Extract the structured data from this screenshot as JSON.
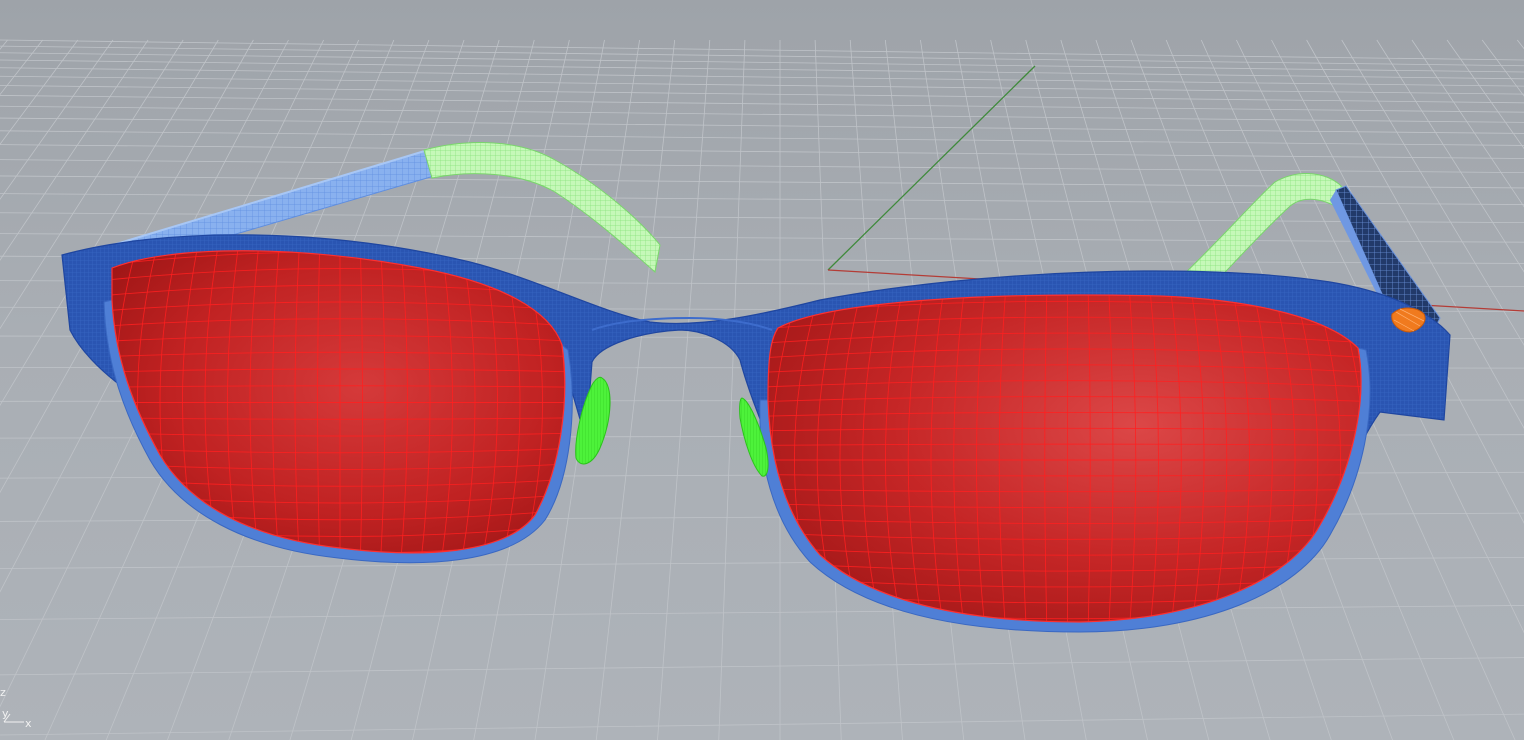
{
  "viewport": {
    "projection": "perspective",
    "colors": {
      "background": "#a6abb1",
      "grid": "#bfc3c8",
      "world_x_axis": "#b43c36",
      "world_y_axis": "#3f8a3b",
      "frame": "#2a57b4",
      "frame_edge": "#4f7fd6",
      "lens": "#c51f1f",
      "lens_wire": "#ff2020",
      "temple_tip": "#b6f7a9",
      "nose_pad": "#3ff22a",
      "hinge": "#f07a1e"
    }
  },
  "axis_widget": {
    "z_label": "z",
    "y_label": "y",
    "x_label": "x"
  },
  "model": {
    "objects": [
      {
        "name": "left-lens",
        "icon": "lens-surface"
      },
      {
        "name": "right-lens",
        "icon": "lens-surface"
      },
      {
        "name": "front-frame",
        "icon": "frame-mesh"
      },
      {
        "name": "left-temple-arm",
        "icon": "temple-mesh"
      },
      {
        "name": "right-temple-arm",
        "icon": "temple-mesh"
      },
      {
        "name": "left-temple-tip",
        "icon": "temple-tip-mesh"
      },
      {
        "name": "right-temple-tip",
        "icon": "temple-tip-mesh"
      },
      {
        "name": "left-nose-pad",
        "icon": "nose-pad-mesh"
      },
      {
        "name": "right-nose-pad",
        "icon": "nose-pad-mesh"
      },
      {
        "name": "right-hinge",
        "icon": "hinge-mesh"
      }
    ]
  }
}
